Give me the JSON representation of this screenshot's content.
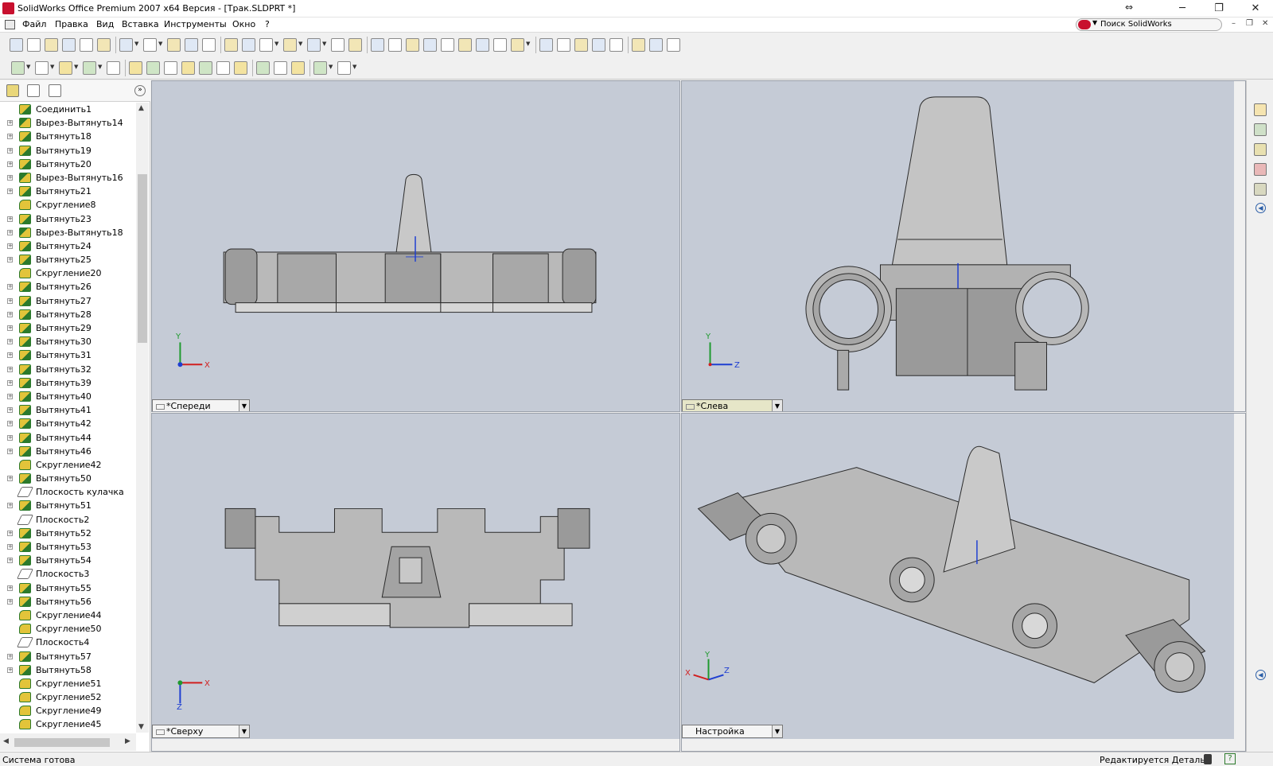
{
  "window": {
    "title": "SolidWorks Office Premium 2007 x64 Версия - [Трак.SLDPRT *]",
    "restore_label": "⇔",
    "minimize_label": "─",
    "maximize_label": "❐",
    "close_label": "✕"
  },
  "menu": {
    "items": [
      "Файл",
      "Правка",
      "Вид",
      "Вставка",
      "Инструменты",
      "Окно",
      "?"
    ],
    "search_placeholder": "Поиск SolidWorks",
    "mdi_minimize": "–",
    "mdi_restore": "❐",
    "mdi_close": "✕"
  },
  "toolbar_top": {
    "icons": [
      "new-icon",
      "open-icon",
      "save-icon",
      "print-icon",
      "print-preview-icon",
      "options-icon",
      "undo-icon",
      "redo-icon",
      "select-icon",
      "select-other-icon",
      "rebuild-icon",
      "grid-icon",
      "sketch-icon",
      "smart-dimension-icon",
      "3d-box-icon",
      "layers-icon",
      "properties-icon",
      "help-icon",
      "measure-icon",
      "zoom-fit-icon",
      "zoom-area-icon",
      "zoom-in-icon",
      "zoom-out-icon",
      "rotate-icon",
      "pan-icon",
      "roll-icon",
      "view-orientation-icon",
      "wireframe-icon",
      "hidden-lines-icon",
      "hidden-removed-icon",
      "shaded-edges-icon",
      "shaded-icon",
      "section-view-icon",
      "draft-quality-icon",
      "realview-icon"
    ],
    "colors": {
      "icon_outline": "#8a8a8a",
      "accent": "#2c5fa8"
    }
  },
  "toolbar_features": {
    "icons": [
      "extrude-boss-icon",
      "revolve-icon",
      "sweep-icon",
      "loft-icon",
      "extrude-cut-icon",
      "fillet-icon",
      "chamfer-icon",
      "rib-icon",
      "shell-icon",
      "draft-icon",
      "dome-icon",
      "hole-wizard-icon",
      "linear-pattern-icon",
      "circular-pattern-icon",
      "mirror-icon",
      "reference-geometry-icon",
      "curves-icon"
    ],
    "colors": {
      "green": "#2c7a2c",
      "yellow": "#e2c43a"
    }
  },
  "feature_tree": {
    "items": [
      {
        "label": "Соединить1",
        "type": "extrude",
        "expandable": false
      },
      {
        "label": "Вырез-Вытянуть14",
        "type": "cut",
        "expandable": true
      },
      {
        "label": "Вытянуть18",
        "type": "extrude",
        "expandable": true
      },
      {
        "label": "Вытянуть19",
        "type": "extrude",
        "expandable": true
      },
      {
        "label": "Вытянуть20",
        "type": "extrude",
        "expandable": true
      },
      {
        "label": "Вырез-Вытянуть16",
        "type": "cut",
        "expandable": true
      },
      {
        "label": "Вытянуть21",
        "type": "extrude",
        "expandable": true
      },
      {
        "label": "Скругление8",
        "type": "fillet",
        "expandable": false
      },
      {
        "label": "Вытянуть23",
        "type": "extrude",
        "expandable": true
      },
      {
        "label": "Вырез-Вытянуть18",
        "type": "cut",
        "expandable": true
      },
      {
        "label": "Вытянуть24",
        "type": "extrude",
        "expandable": true
      },
      {
        "label": "Вытянуть25",
        "type": "extrude",
        "expandable": true
      },
      {
        "label": "Скругление20",
        "type": "fillet",
        "expandable": false
      },
      {
        "label": "Вытянуть26",
        "type": "extrude",
        "expandable": true
      },
      {
        "label": "Вытянуть27",
        "type": "extrude",
        "expandable": true
      },
      {
        "label": "Вытянуть28",
        "type": "extrude",
        "expandable": true
      },
      {
        "label": "Вытянуть29",
        "type": "extrude",
        "expandable": true
      },
      {
        "label": "Вытянуть30",
        "type": "extrude",
        "expandable": true
      },
      {
        "label": "Вытянуть31",
        "type": "extrude",
        "expandable": true
      },
      {
        "label": "Вытянуть32",
        "type": "extrude",
        "expandable": true
      },
      {
        "label": "Вытянуть39",
        "type": "extrude",
        "expandable": true
      },
      {
        "label": "Вытянуть40",
        "type": "extrude",
        "expandable": true
      },
      {
        "label": "Вытянуть41",
        "type": "extrude",
        "expandable": true
      },
      {
        "label": "Вытянуть42",
        "type": "extrude",
        "expandable": true
      },
      {
        "label": "Вытянуть44",
        "type": "extrude",
        "expandable": true
      },
      {
        "label": "Вытянуть46",
        "type": "extrude",
        "expandable": true
      },
      {
        "label": "Скругление42",
        "type": "fillet",
        "expandable": false
      },
      {
        "label": "Вытянуть50",
        "type": "extrude",
        "expandable": true
      },
      {
        "label": "Плоскость кулачка",
        "type": "plane",
        "expandable": false
      },
      {
        "label": "Вытянуть51",
        "type": "extrude",
        "expandable": true
      },
      {
        "label": "Плоскость2",
        "type": "plane",
        "expandable": false
      },
      {
        "label": "Вытянуть52",
        "type": "extrude",
        "expandable": true
      },
      {
        "label": "Вытянуть53",
        "type": "extrude",
        "expandable": true
      },
      {
        "label": "Вытянуть54",
        "type": "extrude",
        "expandable": true
      },
      {
        "label": "Плоскость3",
        "type": "plane",
        "expandable": false
      },
      {
        "label": "Вытянуть55",
        "type": "extrude",
        "expandable": true
      },
      {
        "label": "Вытянуть56",
        "type": "extrude",
        "expandable": true
      },
      {
        "label": "Скругление44",
        "type": "fillet",
        "expandable": false
      },
      {
        "label": "Скругление50",
        "type": "fillet",
        "expandable": false
      },
      {
        "label": "Плоскость4",
        "type": "plane",
        "expandable": false
      },
      {
        "label": "Вытянуть57",
        "type": "extrude",
        "expandable": true
      },
      {
        "label": "Вытянуть58",
        "type": "extrude",
        "expandable": true
      },
      {
        "label": "Скругление51",
        "type": "fillet",
        "expandable": false
      },
      {
        "label": "Скругление52",
        "type": "fillet",
        "expandable": false
      },
      {
        "label": "Скругление49",
        "type": "fillet",
        "expandable": false
      },
      {
        "label": "Скругление45",
        "type": "fillet",
        "expandable": false
      }
    ],
    "panel_tabs": [
      "feature-manager-icon",
      "property-manager-icon",
      "configuration-manager-icon"
    ],
    "expand_label": "»"
  },
  "viewports": {
    "front": {
      "label": "*Спереди"
    },
    "left": {
      "label": "*Слева"
    },
    "top": {
      "label": "*Сверху"
    },
    "iso": {
      "label": "Настройка"
    },
    "axis_labels": {
      "x": "X",
      "y": "Y",
      "z": "Z"
    },
    "colors": {
      "background": "#c5cbd6",
      "part_fill": "#b9b9b9",
      "part_dark": "#8e8e8e",
      "part_light": "#d6d6d6",
      "edge": "#2a2a2a",
      "axis_x": "#d11f1f",
      "axis_y": "#1f9a2f",
      "axis_z": "#1f3fd1"
    }
  },
  "task_pane": {
    "icons": [
      "home-icon",
      "design-library-icon",
      "file-explorer-icon",
      "search-icon",
      "view-palette-icon",
      "appearances-icon"
    ]
  },
  "status": {
    "left": "Система готова",
    "right": "Редактируется Деталь",
    "rebuild_icon": "rebuild-light-icon",
    "help_icon": "help-icon",
    "help_label": "?"
  }
}
